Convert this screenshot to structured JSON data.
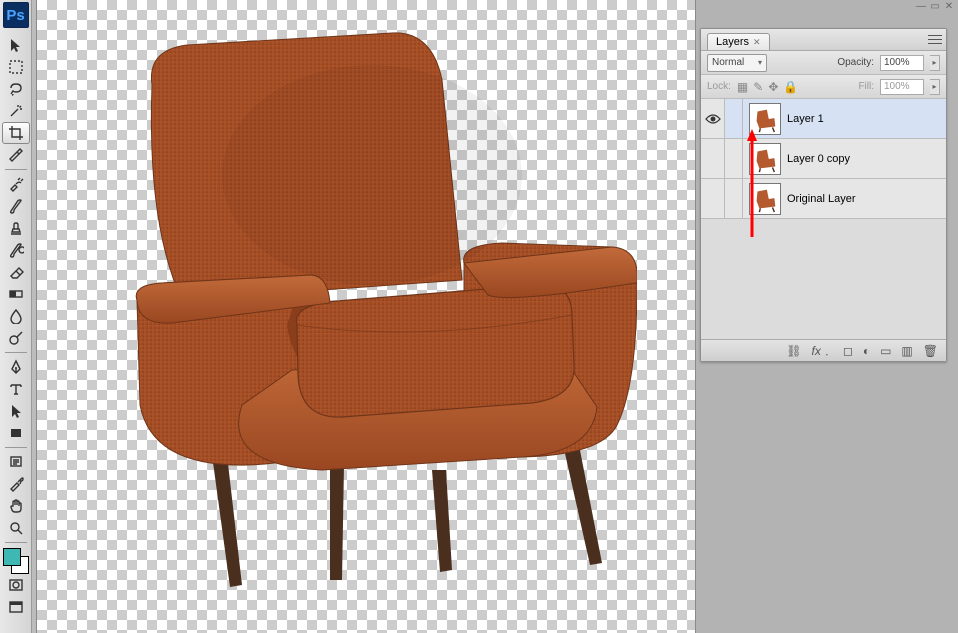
{
  "app": {
    "logo": "Ps"
  },
  "tools": [
    {
      "name": "move-tool"
    },
    {
      "name": "marquee-tool"
    },
    {
      "name": "lasso-tool"
    },
    {
      "name": "magic-wand-tool"
    },
    {
      "name": "crop-tool",
      "active": true
    },
    {
      "name": "slice-tool"
    },
    {
      "sep": true
    },
    {
      "name": "healing-brush-tool"
    },
    {
      "name": "brush-tool"
    },
    {
      "name": "clone-stamp-tool"
    },
    {
      "name": "history-brush-tool"
    },
    {
      "name": "eraser-tool"
    },
    {
      "name": "gradient-tool"
    },
    {
      "name": "blur-tool"
    },
    {
      "name": "dodge-tool"
    },
    {
      "sep": true
    },
    {
      "name": "pen-tool"
    },
    {
      "name": "type-tool"
    },
    {
      "name": "path-selection-tool"
    },
    {
      "name": "rectangle-shape-tool"
    },
    {
      "sep": true
    },
    {
      "name": "notes-tool"
    },
    {
      "name": "eyedropper-tool"
    },
    {
      "name": "hand-tool"
    },
    {
      "name": "zoom-tool"
    },
    {
      "sep": true
    }
  ],
  "swatch": {
    "fg": "#3fb7b3",
    "bg": "#ffffff"
  },
  "layers_panel": {
    "tab_label": "Layers",
    "blend_mode": "Normal",
    "opacity_label": "Opacity:",
    "opacity_value": "100%",
    "lock_label": "Lock:",
    "fill_label": "Fill:",
    "fill_value": "100%",
    "layers": [
      {
        "visible": true,
        "name": "Layer 1",
        "selected": true
      },
      {
        "visible": false,
        "name": "Layer 0 copy",
        "selected": false
      },
      {
        "visible": false,
        "name": "Original Layer",
        "selected": false
      }
    ]
  }
}
